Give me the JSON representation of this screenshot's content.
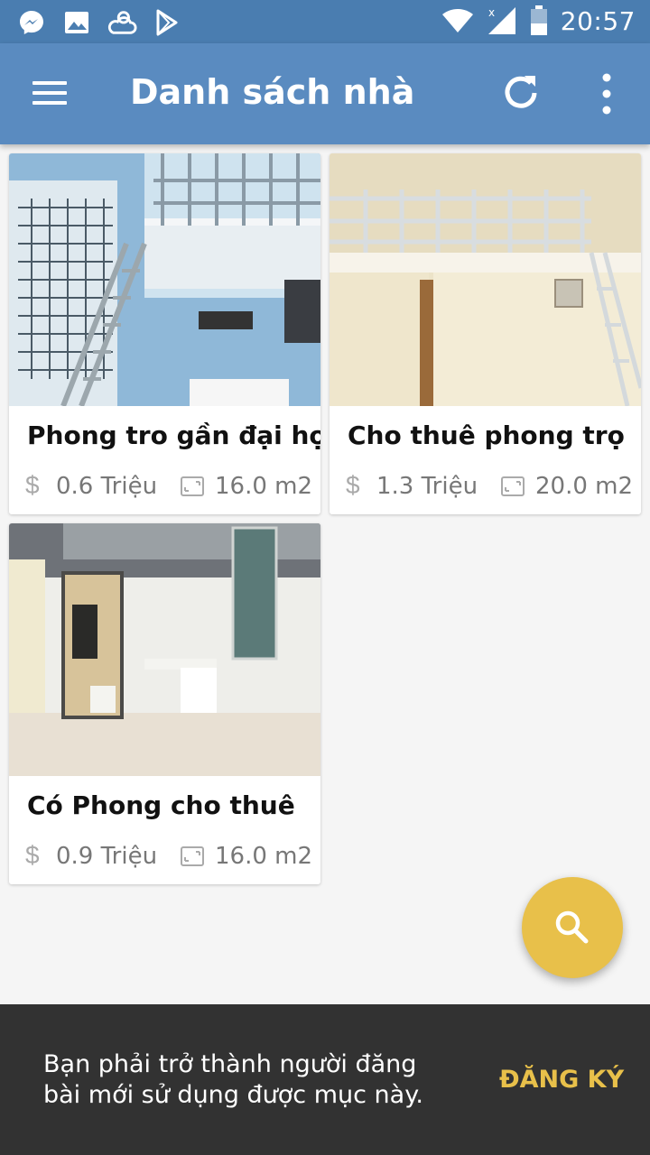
{
  "status_bar": {
    "time": "20:57",
    "icons": [
      "messenger-icon",
      "image-icon",
      "weather-icon",
      "play-store-icon",
      "wifi-icon",
      "signal-icon",
      "battery-icon"
    ]
  },
  "app_bar": {
    "title": "Danh sách nhà",
    "background": "#5a8bc0"
  },
  "listings": [
    {
      "title": "Phong tro gần đại học",
      "price": "0.6 Triệu",
      "area": "16.0 m2"
    },
    {
      "title": "Cho thuê phong trọ",
      "price": "1.3 Triệu",
      "area": "20.0 m2"
    },
    {
      "title": "Có Phong cho thuê",
      "price": "0.9 Triệu",
      "area": "16.0 m2"
    }
  ],
  "price_symbol": "$",
  "fab": {
    "icon": "search-icon",
    "color": "#e8c04a"
  },
  "snackbar": {
    "message": "Bạn phải trở thành người đăng bài mới sử dụng được mục này.",
    "action": "ĐĂNG KÝ"
  }
}
